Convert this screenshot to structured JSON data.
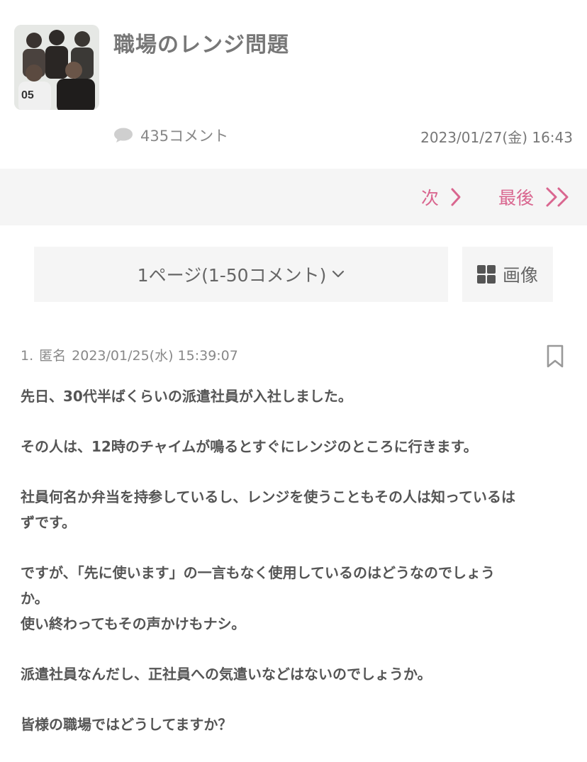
{
  "topic": {
    "title": "職場のレンジ問題",
    "comment_count": "435コメント",
    "date": "2023/01/27(金) 16:43"
  },
  "nav": {
    "next_label": "次",
    "last_label": "最後"
  },
  "pager": {
    "label": "1ページ(1-50コメント)",
    "image_label": "画像"
  },
  "post": {
    "number": "1.",
    "author": "匿名",
    "date": "2023/01/25(水) 15:39:07",
    "paragraphs": [
      [
        "先日、30代半ばくらいの派遣社員が入社しました。"
      ],
      [
        "その人は、12時のチャイムが鳴るとすぐにレンジのところに行きます。"
      ],
      [
        "社員何名か弁当を持参しているし、レンジを使うこともその人は知っているは",
        "ずです。"
      ],
      [
        "ですが、「先に使います」の一言もなく使用しているのはどうなのでしょう",
        "か。",
        "使い終わってもその声かけもナシ。"
      ],
      [
        "派遣社員なんだし、正社員への気遣いなどはないのでしょうか。"
      ],
      [
        "皆様の職場ではどうしてますか？"
      ]
    ]
  },
  "colors": {
    "accent": "#d9668f",
    "bar_bg": "#f5f5f5"
  },
  "icons": [
    "comment-bubble-icon",
    "chevron-right-icon",
    "double-chevron-right-icon",
    "chevron-down-icon",
    "grid-icon",
    "bookmark-icon"
  ]
}
